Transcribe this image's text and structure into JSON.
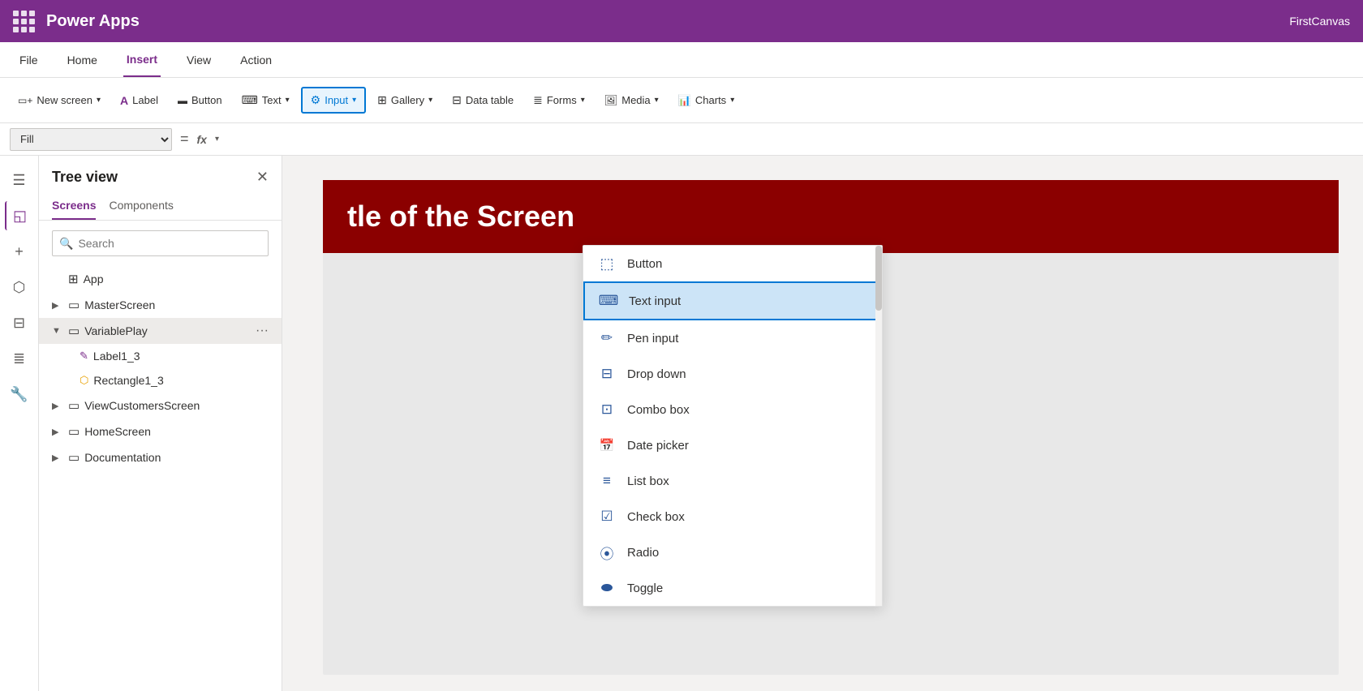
{
  "app": {
    "title": "Power Apps",
    "right_label": "FirstCanvas"
  },
  "menu": {
    "items": [
      "File",
      "Home",
      "Insert",
      "View",
      "Action"
    ],
    "active": "Insert"
  },
  "toolbar": {
    "new_screen": "New screen",
    "label": "Label",
    "button": "Button",
    "text": "Text",
    "input": "Input",
    "gallery": "Gallery",
    "data_table": "Data table",
    "forms": "Forms",
    "media": "Media",
    "charts": "Charts"
  },
  "formula_bar": {
    "fill_label": "Fill",
    "fx_label": "fx"
  },
  "tree_view": {
    "title": "Tree view",
    "tabs": [
      "Screens",
      "Components"
    ],
    "active_tab": "Screens",
    "search_placeholder": "Search",
    "items": [
      {
        "label": "App",
        "icon": "app",
        "indent": 0,
        "arrow": false
      },
      {
        "label": "MasterScreen",
        "icon": "screen",
        "indent": 0,
        "arrow": "right"
      },
      {
        "label": "VariablePlay",
        "icon": "screen",
        "indent": 0,
        "arrow": "down",
        "dots": true,
        "expanded": true
      },
      {
        "label": "Label1_3",
        "icon": "label",
        "indent": 1
      },
      {
        "label": "Rectangle1_3",
        "icon": "rect",
        "indent": 1
      },
      {
        "label": "ViewCustomersScreen",
        "icon": "screen",
        "indent": 0,
        "arrow": "right"
      },
      {
        "label": "HomeScreen",
        "icon": "screen",
        "indent": 0,
        "arrow": "right"
      },
      {
        "label": "Documentation",
        "icon": "screen",
        "indent": 0,
        "arrow": "right"
      }
    ]
  },
  "dropdown": {
    "items": [
      {
        "id": "button",
        "label": "Button",
        "icon": "btn"
      },
      {
        "id": "text-input",
        "label": "Text input",
        "icon": "textinput",
        "highlighted": true
      },
      {
        "id": "pen-input",
        "label": "Pen input",
        "icon": "pen"
      },
      {
        "id": "drop-down",
        "label": "Drop down",
        "icon": "dropdown"
      },
      {
        "id": "combo-box",
        "label": "Combo box",
        "icon": "combobox"
      },
      {
        "id": "date-picker",
        "label": "Date picker",
        "icon": "datepicker"
      },
      {
        "id": "list-box",
        "label": "List box",
        "icon": "listbox"
      },
      {
        "id": "check-box",
        "label": "Check box",
        "icon": "checkbox"
      },
      {
        "id": "radio",
        "label": "Radio",
        "icon": "radio"
      },
      {
        "id": "toggle",
        "label": "Toggle",
        "icon": "toggle"
      }
    ]
  },
  "canvas": {
    "red_bar_text": "tle of the Screen"
  }
}
